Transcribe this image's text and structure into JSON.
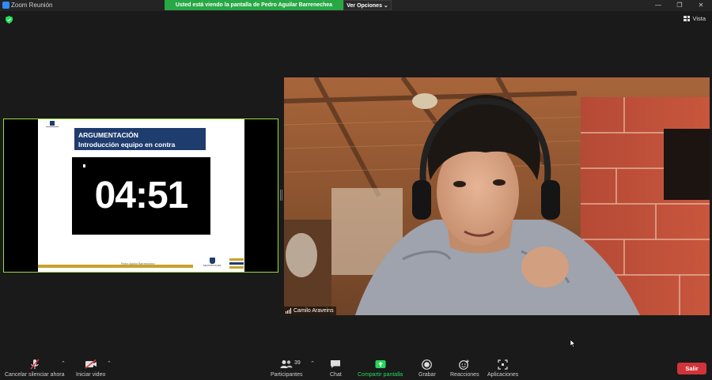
{
  "window": {
    "app_title": "Zoom Reunión",
    "share_banner": "Usted está viendo la pantalla de Pedro Aguilar Barrenechea",
    "view_options_label": "Ver Opciones ⌄",
    "controls": [
      "—",
      "❐",
      "✕"
    ]
  },
  "top": {
    "view_label": "Vista"
  },
  "shared_screen": {
    "slide_title": "ARGUMENTACIÓN",
    "slide_subtitle": "Introducción equipo en contra",
    "timer": "04:51",
    "footer_text": "Pedro Aguilar Barrenechea",
    "logo_text": "MONTESSORI"
  },
  "camera": {
    "participant_name": "Camilo Araveins"
  },
  "toolbar": {
    "mute_label": "Cancelar silenciar ahora",
    "video_label": "Iniciar video",
    "participants_label": "Participantes",
    "participants_count": "39",
    "chat_label": "Chat",
    "share_label": "Compartir pantalla",
    "record_label": "Grabar",
    "reactions_label": "Reacciones",
    "apps_label": "Aplicaciones",
    "leave_label": "Salir"
  },
  "colors": {
    "share_green": "#27a844",
    "share_border": "#96e03c",
    "slide_blue": "#1f3c6e",
    "slide_gold": "#c8a22a",
    "leave_red": "#d0343a",
    "share_icon": "#23d959"
  }
}
